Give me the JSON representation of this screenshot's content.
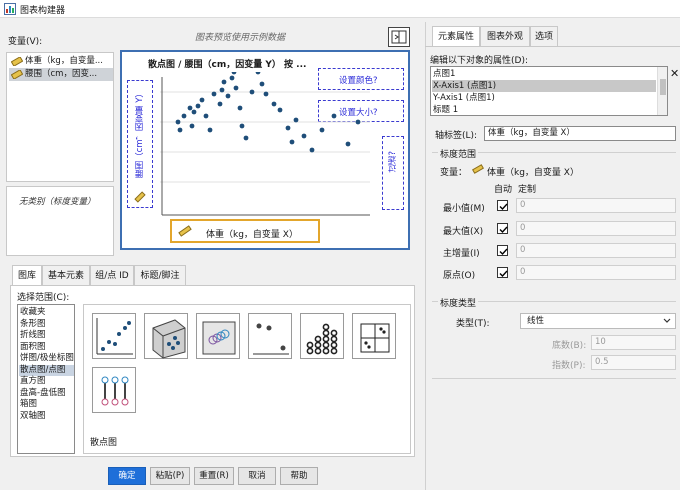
{
  "window": {
    "title": "图表构建器"
  },
  "variables": {
    "label": "变量(V):",
    "items": [
      "体重（kg，自变量...",
      "腰围（cm，因变..."
    ],
    "no_category": "无类别（标度变量）"
  },
  "preview": {
    "hint": "图表预览使用示例数据",
    "chart_title": "散点图 / 腰围（cm，因变量 Y） 按 ...",
    "set_color": "设置颜色?",
    "set_size": "设置大小?",
    "filter": "过滤?",
    "y_drop": "腰围（cm，因变量 Y）",
    "x_drop": "体重（kg，自变量 X）"
  },
  "gallery": {
    "tabs": [
      "图库",
      "基本元素",
      "组/点 ID",
      "标题/脚注"
    ],
    "choose_label": "选择范围(C):",
    "categories": [
      "收藏夹",
      "条形图",
      "折线图",
      "面积图",
      "饼图/极坐标图",
      "散点图/点图",
      "直方图",
      "盘高-盘低图",
      "箱图",
      "双轴图"
    ],
    "selected_category": 5,
    "caption": "散点图"
  },
  "buttons": {
    "ok": "确定",
    "paste": "粘贴(P)",
    "reset": "重置(R)",
    "cancel": "取消",
    "help": "帮助"
  },
  "right": {
    "tabs": [
      "元素属性",
      "图表外观",
      "选项"
    ],
    "edit_label": "编辑以下对象的属性(D):",
    "objects": [
      "点图1",
      "X-Axis1 (点图1)",
      "Y-Axis1 (点图1)",
      "标题 1"
    ],
    "selected_object": 1,
    "axis_label_label": "轴标签(L):",
    "axis_label_value": "体重（kg，自变量 X）",
    "scale_range": "标度范围",
    "variable_label": "变量：",
    "variable_value": "体重（kg，自变量 X）",
    "auto": "自动",
    "custom": "定制",
    "rows": [
      {
        "label": "最小值(M)",
        "value": "0"
      },
      {
        "label": "最大值(X)",
        "value": "0"
      },
      {
        "label": "主增量(I)",
        "value": "0"
      },
      {
        "label": "原点(O)",
        "value": "0"
      }
    ],
    "scale_type": "标度类型",
    "type_label": "类型(T):",
    "type_value": "线性",
    "base_label": "底数(B):",
    "base_value": "10",
    "exponent_label": "指数(P):",
    "exponent_value": "0.5"
  },
  "colors": {
    "accent": "#1e6fd9",
    "preview_border": "#3d6fb2",
    "dashed": "#3a3ad0",
    "x_drop": "#e3a62c",
    "dot": "#1f4e79"
  }
}
